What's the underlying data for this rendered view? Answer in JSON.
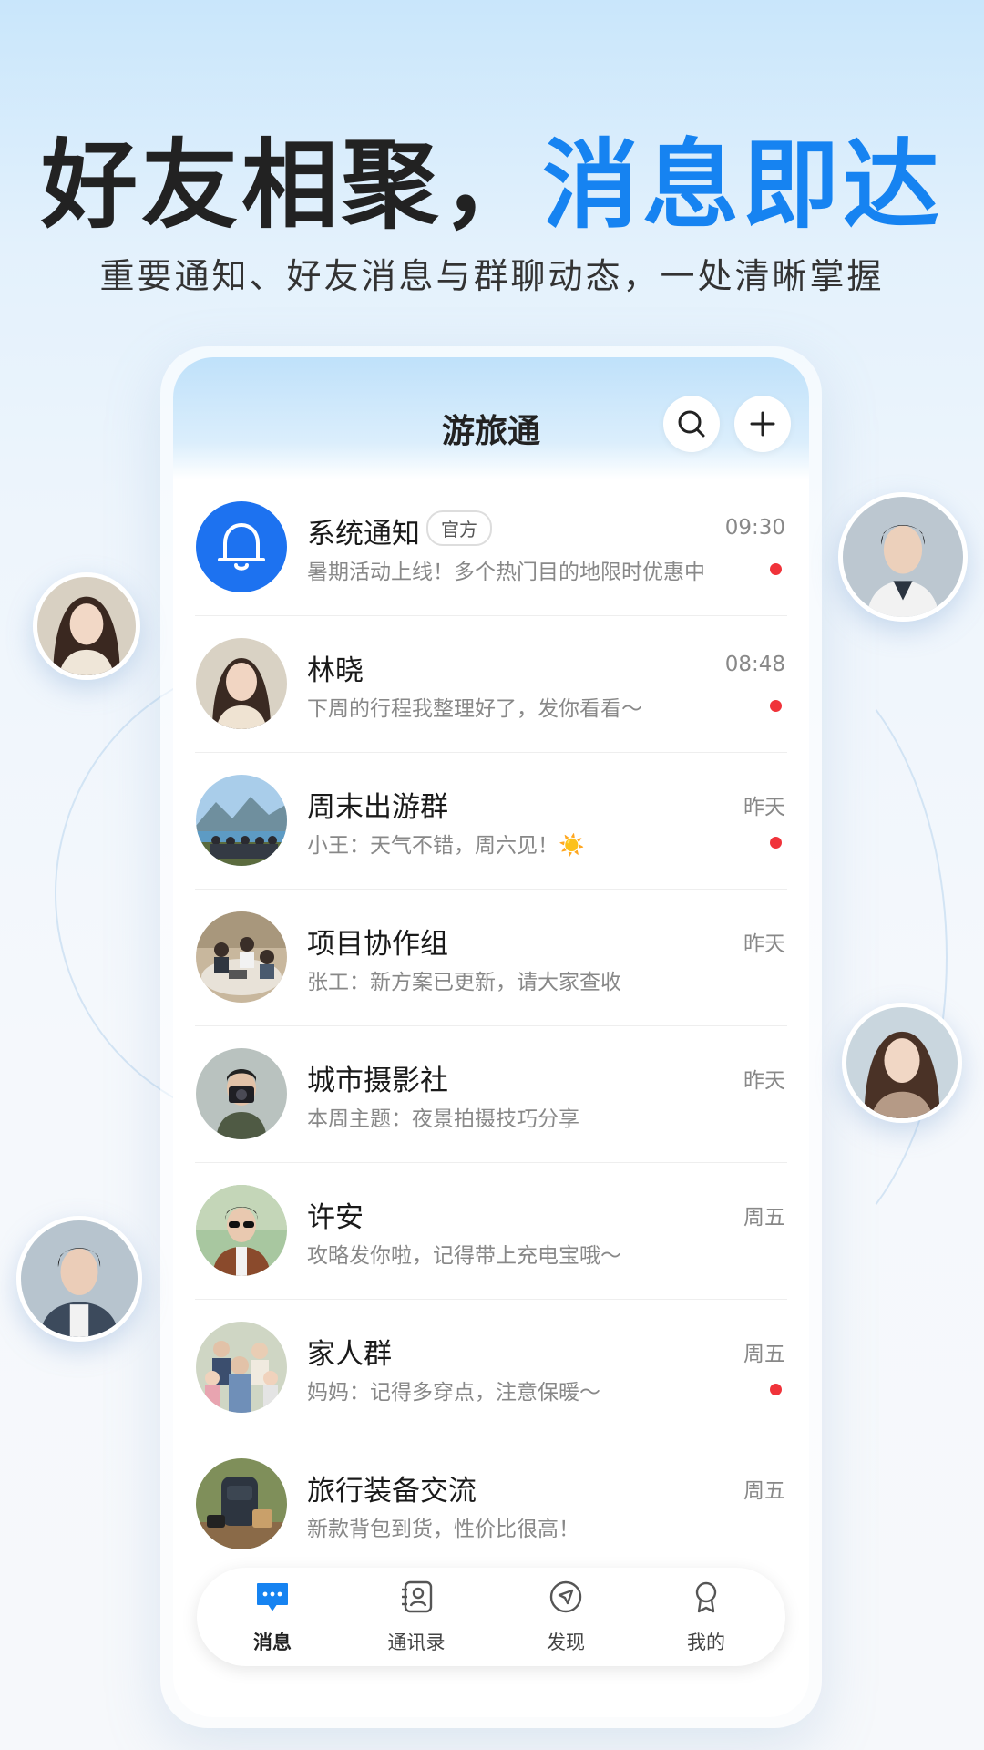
{
  "hero": {
    "title_part1": "好友相聚，",
    "title_part2": "消息即达",
    "subtitle": "重要通知、好友消息与群聊动态，一处清晰掌握"
  },
  "app": {
    "title": "游旅通",
    "search_icon": "search-icon",
    "add_icon": "plus-icon"
  },
  "colors": {
    "accent": "#1683f1",
    "unread_dot": "#f0333a"
  },
  "conversations": [
    {
      "name": "系统通知",
      "badge": "官方",
      "preview": "暑期活动上线！多个热门目的地限时优惠中",
      "time": "09:30",
      "unread": true
    },
    {
      "name": "林晓",
      "preview": "下周的行程我整理好了，发你看看～",
      "time": "08:48",
      "unread": true
    },
    {
      "name": "周末出游群",
      "preview": "小王：天气不错，周六见！☀️",
      "time": "昨天",
      "unread": true
    },
    {
      "name": "项目协作组",
      "preview": "张工：新方案已更新，请大家查收",
      "time": "昨天",
      "unread": false
    },
    {
      "name": "城市摄影社",
      "preview": "本周主题：夜景拍摄技巧分享",
      "time": "昨天",
      "unread": false
    },
    {
      "name": "许安",
      "preview": "攻略发你啦，记得带上充电宝哦～",
      "time": "周五",
      "unread": false
    },
    {
      "name": "家人群",
      "preview": "妈妈：记得多穿点，注意保暖～",
      "time": "周五",
      "unread": true
    },
    {
      "name": "旅行装备交流",
      "preview": "新款背包到货，性价比很高！",
      "time": "周五",
      "unread": false
    }
  ],
  "tabs": [
    {
      "label": "消息",
      "icon": "chat-bubble-icon",
      "active": true
    },
    {
      "label": "通讯录",
      "icon": "contacts-icon",
      "active": false
    },
    {
      "label": "发现",
      "icon": "compass-icon",
      "active": false
    },
    {
      "label": "我的",
      "icon": "profile-icon",
      "active": false
    }
  ]
}
